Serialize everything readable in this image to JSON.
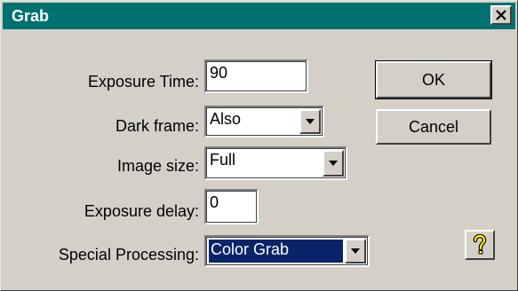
{
  "window": {
    "title": "Grab",
    "title_bar_color": "#007070",
    "close_icon": "close-icon"
  },
  "form": {
    "exposure_time": {
      "label": "Exposure Time:",
      "value": "90"
    },
    "dark_frame": {
      "label": "Dark frame:",
      "value": "Also"
    },
    "image_size": {
      "label": "Image size:",
      "value": "Full"
    },
    "exposure_delay": {
      "label": "Exposure delay:",
      "value": "0"
    },
    "special_processing": {
      "label": "Special Processing:",
      "value": "Color Grab",
      "selected_color": "#0a246a"
    }
  },
  "buttons": {
    "ok": "OK",
    "cancel": "Cancel",
    "help_icon": "question-mark-icon"
  }
}
